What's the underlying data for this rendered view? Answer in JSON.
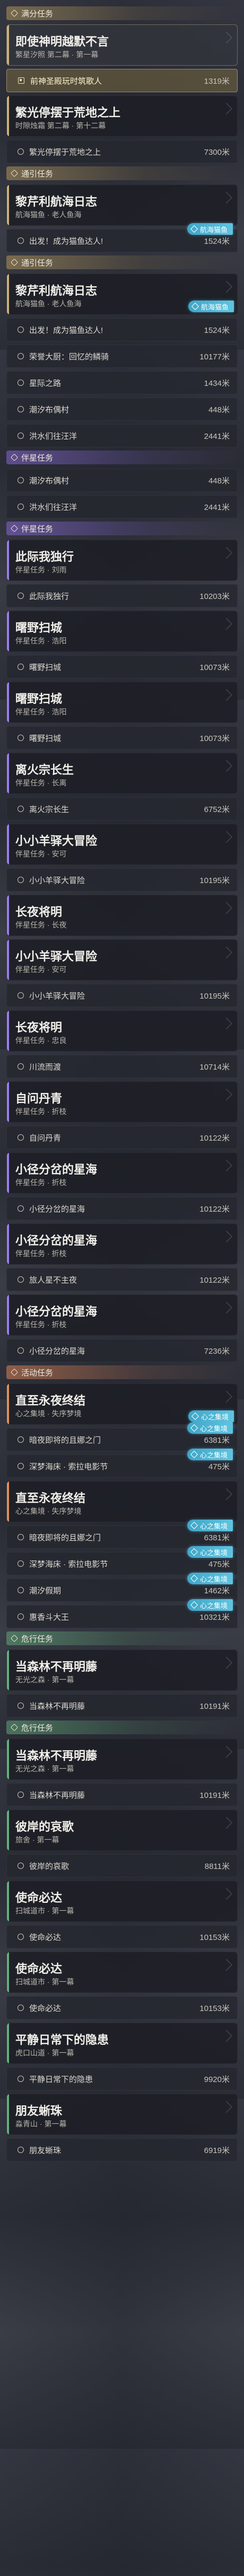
{
  "sections": [
    {
      "type": "category",
      "color": "gold",
      "label": "满分任务"
    },
    {
      "type": "card",
      "color": "gold",
      "title": "即使神明越默不言",
      "subtitle": "繁星汐照 第二幕 · 第一幕",
      "active": true
    },
    {
      "type": "subtask",
      "text": "前神圣殿玩时筑歌人",
      "distance": "1319米",
      "active": true
    },
    {
      "type": "card",
      "color": "gold",
      "title": "繁光停摆于荒地之上",
      "subtitle": "时隙烛霜 第二幕 · 第十二幕"
    },
    {
      "type": "subtask",
      "text": "繁光停摆于荒地之上",
      "distance": "7300米"
    },
    {
      "type": "category",
      "color": "gold",
      "label": "通引任务"
    },
    {
      "type": "card",
      "color": "gold",
      "title": "黎芹利航海日志",
      "subtitle": "航海猫鱼 · 老人鱼海"
    },
    {
      "type": "subtask",
      "text": "出发！成为猫鱼达人!",
      "distance": "1524米",
      "badge": "航海猫鱼"
    },
    {
      "type": "category",
      "color": "gold",
      "label": "通引任务"
    },
    {
      "type": "card",
      "color": "gold",
      "title": "黎芹利航海日志",
      "subtitle": "航海猫鱼 · 老人鱼海",
      "badge": "航海猫鱼"
    },
    {
      "type": "subtask",
      "text": "出发！成为猫鱼达人!",
      "distance": "1524米"
    },
    {
      "type": "subtask",
      "text": "荣誉大厨：回忆的鳞骑",
      "distance": "10177米"
    },
    {
      "type": "subtask",
      "text": "星际之路",
      "distance": "1434米"
    },
    {
      "type": "subtask",
      "text": "潮汐布偶村",
      "distance": "448米"
    },
    {
      "type": "subtask",
      "text": "洪水们往汪洋",
      "distance": "2441米"
    },
    {
      "type": "category",
      "color": "purple",
      "label": "伴星任务"
    },
    {
      "type": "subtask",
      "text": "潮汐布偶村",
      "distance": "448米"
    },
    {
      "type": "subtask",
      "text": "洪水们往汪洋",
      "distance": "2441米"
    },
    {
      "type": "category",
      "color": "purple",
      "label": "伴星任务"
    },
    {
      "type": "card",
      "color": "purple",
      "title": "此际我独行",
      "subtitle": "伴星任务 · 刘雨"
    },
    {
      "type": "subtask",
      "text": "此际我独行",
      "distance": "10203米"
    },
    {
      "type": "card",
      "color": "purple",
      "title": "曙野扫城",
      "subtitle": "伴星任务 · 浩阳"
    },
    {
      "type": "subtask",
      "text": "曙野扫城",
      "distance": "10073米"
    },
    {
      "type": "card",
      "color": "purple",
      "title": "曙野扫城",
      "subtitle": "伴星任务 · 浩阳"
    },
    {
      "type": "subtask",
      "text": "曙野扫城",
      "distance": "10073米"
    },
    {
      "type": "card",
      "color": "purple",
      "title": "离火宗长生",
      "subtitle": "伴星任务 · 长离"
    },
    {
      "type": "subtask",
      "text": "离火宗长生",
      "distance": "6752米"
    },
    {
      "type": "card",
      "color": "purple",
      "title": "小小羊驿大冒险",
      "subtitle": "伴星任务 · 安可"
    },
    {
      "type": "subtask",
      "text": "小小羊驿大冒险",
      "distance": "10195米"
    },
    {
      "type": "card",
      "color": "purple",
      "title": "长夜将明",
      "subtitle": "伴星任务 · 长夜"
    },
    {
      "type": "card",
      "color": "purple",
      "title": "小小羊驿大冒险",
      "subtitle": "伴星任务 · 安可"
    },
    {
      "type": "subtask",
      "text": "小小羊驿大冒险",
      "distance": "10195米"
    },
    {
      "type": "card",
      "color": "purple",
      "title": "长夜将明",
      "subtitle": "伴星任务 · 忠良"
    },
    {
      "type": "subtask",
      "text": "川流而渡",
      "distance": "10714米"
    },
    {
      "type": "card",
      "color": "purple",
      "title": "自问丹青",
      "subtitle": "伴星任务 · 折枝"
    },
    {
      "type": "subtask",
      "text": "自问丹青",
      "distance": "10122米"
    },
    {
      "type": "card",
      "color": "purple",
      "title": "小径分岔的星海",
      "subtitle": "伴星任务 · 折枝"
    },
    {
      "type": "subtask",
      "text": "小径分岔的星海",
      "distance": "10122米"
    },
    {
      "type": "card",
      "color": "purple",
      "title": "小径分岔的星海",
      "subtitle": "伴星任务 · 折枝"
    },
    {
      "type": "subtask",
      "text": "旅人星不主夜",
      "distance": "10122米"
    },
    {
      "type": "card",
      "color": "purple",
      "title": "小径分岔的星海",
      "subtitle": "伴星任务 · 折枝"
    },
    {
      "type": "subtask",
      "text": "小径分岔的星海",
      "distance": "7236米"
    },
    {
      "type": "category",
      "color": "orange",
      "label": "活动任务"
    },
    {
      "type": "card",
      "color": "orange",
      "title": "直至永夜终结",
      "subtitle": "心之集境 · 失序梦境",
      "badge": "心之集境"
    },
    {
      "type": "subtask",
      "text": "暗夜即将的且娜之门",
      "distance": "6381米",
      "badge": "心之集境"
    },
    {
      "type": "subtask",
      "text": "深梦海床 · 索拉电影节",
      "distance": "475米",
      "badge": "心之集境"
    },
    {
      "type": "card",
      "color": "orange",
      "title": "直至永夜终结",
      "subtitle": "心之集境 · 失序梦境"
    },
    {
      "type": "subtask",
      "text": "暗夜即将的且娜之门",
      "distance": "6381米",
      "badge": "心之集境"
    },
    {
      "type": "subtask",
      "text": "深梦海床 · 索拉电影节",
      "distance": "475米",
      "badge": "心之集境"
    },
    {
      "type": "subtask",
      "text": "潮汐假期",
      "distance": "1462米",
      "badge": "心之集境"
    },
    {
      "type": "subtask",
      "text": "惠香斗大王",
      "distance": "10321米",
      "badge": "心之集境"
    },
    {
      "type": "category",
      "color": "green",
      "label": "危行任务"
    },
    {
      "type": "card",
      "color": "green",
      "title": "当森林不再明藤",
      "subtitle": "无光之森 · 第一幕"
    },
    {
      "type": "subtask",
      "text": "当森林不再明藤",
      "distance": "10191米"
    },
    {
      "type": "category",
      "color": "green",
      "label": "危行任务"
    },
    {
      "type": "card",
      "color": "green",
      "title": "当森林不再明藤",
      "subtitle": "无光之森 · 第一幕"
    },
    {
      "type": "subtask",
      "text": "当森林不再明藤",
      "distance": "10191米"
    },
    {
      "type": "card",
      "color": "green",
      "title": "彼岸的哀歌",
      "subtitle": "旅舍 · 第一幕"
    },
    {
      "type": "subtask",
      "text": "彼岸的哀歌",
      "distance": "8811米"
    },
    {
      "type": "card",
      "color": "green",
      "title": "使命必达",
      "subtitle": "扫城道市 · 第一幕"
    },
    {
      "type": "subtask",
      "text": "使命必达",
      "distance": "10153米"
    },
    {
      "type": "card",
      "color": "green",
      "title": "使命必达",
      "subtitle": "扫城道市 · 第一幕"
    },
    {
      "type": "subtask",
      "text": "使命必达",
      "distance": "10153米"
    },
    {
      "type": "card",
      "color": "green",
      "title": "平静日常下的隐患",
      "subtitle": "虎口山道 · 第一幕"
    },
    {
      "type": "subtask",
      "text": "平静日常下的隐患",
      "distance": "9920米"
    },
    {
      "type": "card",
      "color": "green",
      "title": "朋友蜥珠",
      "subtitle": "淼青山 · 第一幕"
    },
    {
      "type": "subtask",
      "text": "朋友蜥珠",
      "distance": "6919米"
    }
  ]
}
